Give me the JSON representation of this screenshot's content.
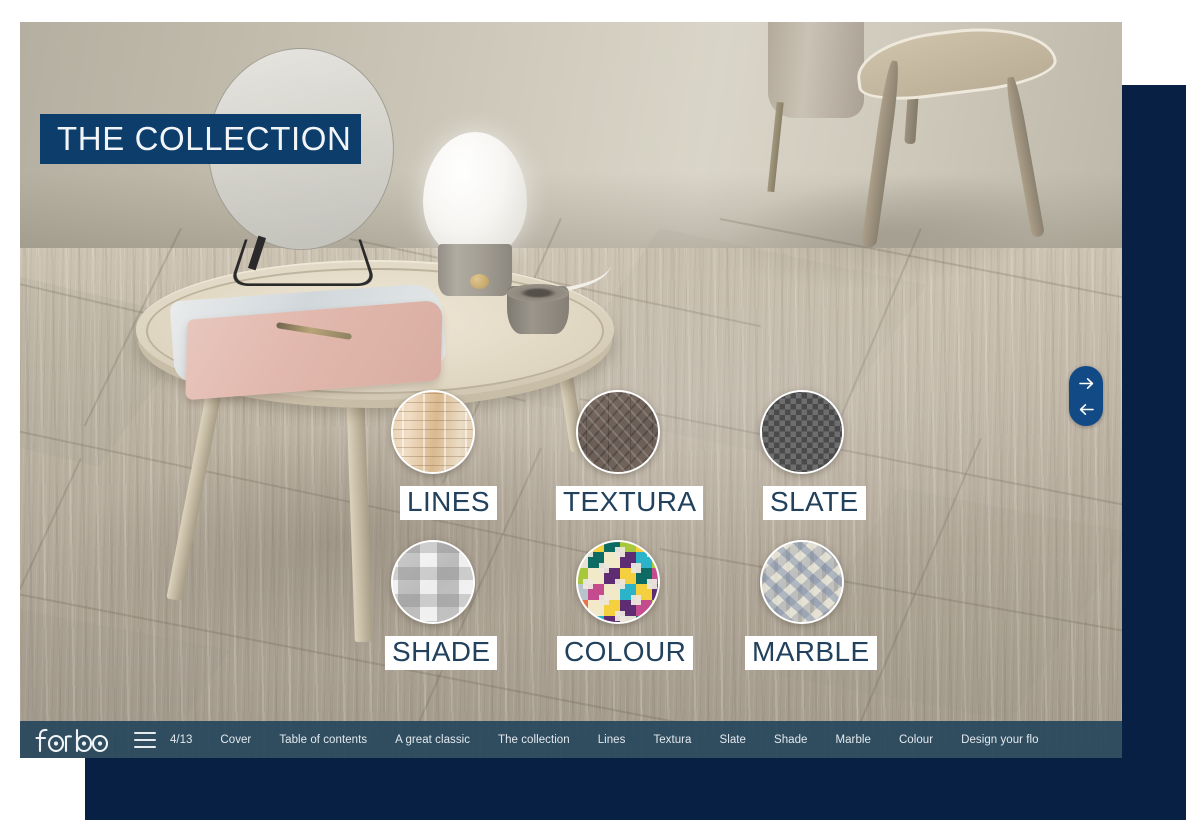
{
  "slide": {
    "title": "THE COLLECTION",
    "banner_color": "#0d3d6b",
    "swatches": [
      {
        "label": "LINES",
        "texture": "lines",
        "row": 1,
        "col": 1
      },
      {
        "label": "TEXTURA",
        "texture": "textura",
        "row": 1,
        "col": 2
      },
      {
        "label": "SLATE",
        "texture": "slate",
        "row": 1,
        "col": 3
      },
      {
        "label": "SHADE",
        "texture": "shade",
        "row": 2,
        "col": 1
      },
      {
        "label": "COLOUR",
        "texture": "colour",
        "row": 2,
        "col": 2
      },
      {
        "label": "MARBLE",
        "texture": "marble",
        "row": 2,
        "col": 3
      }
    ]
  },
  "navigation": {
    "next_icon": "arrow-right-icon",
    "prev_icon": "arrow-left-icon",
    "accent_color": "#124a86"
  },
  "toolbar": {
    "logo_text": "Forbo",
    "menu_icon": "hamburger-menu-icon",
    "page_indicator": "4/13",
    "background_color": "#26465c",
    "items": [
      {
        "label": "Cover"
      },
      {
        "label": "Table of contents"
      },
      {
        "label": "A great classic"
      },
      {
        "label": "The collection"
      },
      {
        "label": "Lines"
      },
      {
        "label": "Textura"
      },
      {
        "label": "Slate"
      },
      {
        "label": "Shade"
      },
      {
        "label": "Marble"
      },
      {
        "label": "Colour"
      },
      {
        "label": "Design your flo"
      }
    ]
  },
  "decoration": {
    "panel_color": "#082043"
  }
}
